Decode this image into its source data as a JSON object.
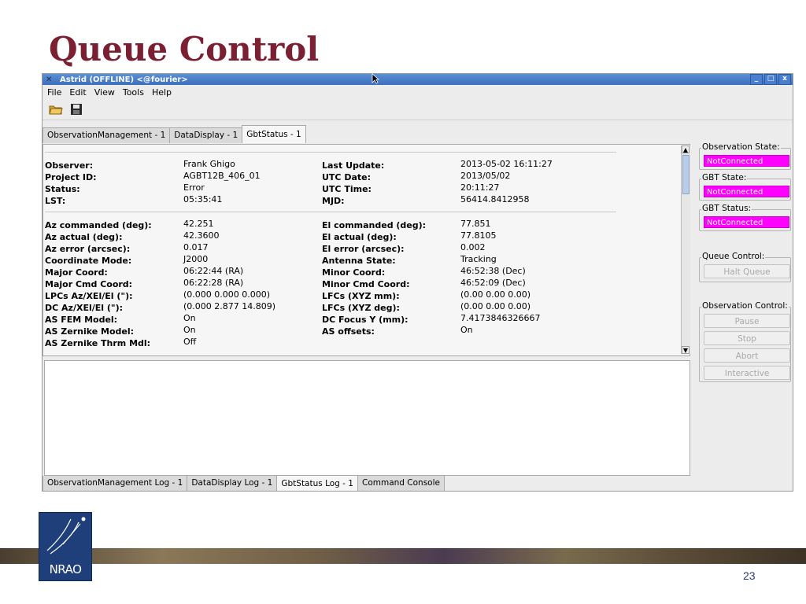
{
  "slide": {
    "title": "Queue Control",
    "page_number": "23",
    "logo_text": "NRAO"
  },
  "window": {
    "title": "Astrid (OFFLINE) <@fourier>",
    "controls": [
      "_",
      "□",
      "x"
    ]
  },
  "menu": [
    "File",
    "Edit",
    "View",
    "Tools",
    "Help"
  ],
  "toolbar_icons": [
    "open-folder-icon",
    "save-icon"
  ],
  "tabs_top": [
    {
      "label": "ObservationManagement - 1",
      "active": false
    },
    {
      "label": "DataDisplay - 1",
      "active": false
    },
    {
      "label": "GbtStatus - 1",
      "active": true
    }
  ],
  "status_left_1": [
    {
      "label": "Observer:",
      "value": "Frank Ghigo"
    },
    {
      "label": "Project ID:",
      "value": "AGBT12B_406_01"
    },
    {
      "label": "Status:",
      "value": "Error"
    },
    {
      "label": "LST:",
      "value": "05:35:41"
    }
  ],
  "status_right_1": [
    {
      "label": "Last Update:",
      "value": "2013-05-02 16:11:27"
    },
    {
      "label": "UTC Date:",
      "value": "2013/05/02"
    },
    {
      "label": "UTC Time:",
      "value": "20:11:27"
    },
    {
      "label": "MJD:",
      "value": "56414.8412958"
    }
  ],
  "status_left_2": [
    {
      "label": "Az commanded (deg):",
      "value": "42.251"
    },
    {
      "label": "Az actual (deg):",
      "value": "42.3600"
    },
    {
      "label": "Az error (arcsec):",
      "value": "0.017"
    },
    {
      "label": "Coordinate Mode:",
      "value": "J2000"
    },
    {
      "label": "Major Coord:",
      "value": "06:22:44 (RA)"
    },
    {
      "label": "Major Cmd Coord:",
      "value": "06:22:28 (RA)"
    },
    {
      "label": "LPCs Az/XEl/El (\"):",
      "value": "(0.000  0.000 0.000)"
    },
    {
      "label": "DC Az/XEl/El (\"):",
      "value": "(0.000  2.877 14.809)"
    },
    {
      "label": "AS FEM Model:",
      "value": "On"
    },
    {
      "label": "AS Zernike Model:",
      "value": "On"
    },
    {
      "label": "AS Zernike Thrm Mdl:",
      "value": "Off"
    }
  ],
  "status_right_2": [
    {
      "label": "El commanded (deg):",
      "value": "77.851"
    },
    {
      "label": "El actual (deg):",
      "value": "77.8105"
    },
    {
      "label": "El error (arcsec):",
      "value": "0.002"
    },
    {
      "label": "Antenna State:",
      "value": "Tracking"
    },
    {
      "label": "Minor Coord:",
      "value": "46:52:38 (Dec)"
    },
    {
      "label": "Minor Cmd Coord:",
      "value": "46:52:09 (Dec)"
    },
    {
      "label": "LFCs (XYZ mm):",
      "value": "(0.00 0.00 0.00)"
    },
    {
      "label": "LFCs (XYZ deg):",
      "value": "(0.00 0.00 0.00)"
    },
    {
      "label": "DC Focus Y (mm):",
      "value": "7.4173846326667"
    },
    {
      "label": "AS offsets:",
      "value": "On"
    }
  ],
  "tabs_bottom": [
    {
      "label": "ObservationManagement Log - 1",
      "active": false
    },
    {
      "label": "DataDisplay Log - 1",
      "active": false
    },
    {
      "label": "GbtStatus Log - 1",
      "active": true
    },
    {
      "label": "Command Console",
      "active": false
    }
  ],
  "side_panel": {
    "observation_state": {
      "title": "Observation State:",
      "value": "NotConnected"
    },
    "gbt_state": {
      "title": "GBT State:",
      "value": "NotConnected"
    },
    "gbt_status": {
      "title": "GBT Status:",
      "value": "NotConnected"
    },
    "queue_control": {
      "title": "Queue Control:",
      "halt_label": "Halt Queue"
    },
    "observation_control": {
      "title": "Observation Control:",
      "buttons": [
        "Pause",
        "Stop",
        "Abort",
        "Interactive"
      ]
    }
  },
  "colors": {
    "title_color": "#7b1f32",
    "not_connected": "#ff00ff",
    "titlebar": "#3c6fbc"
  }
}
